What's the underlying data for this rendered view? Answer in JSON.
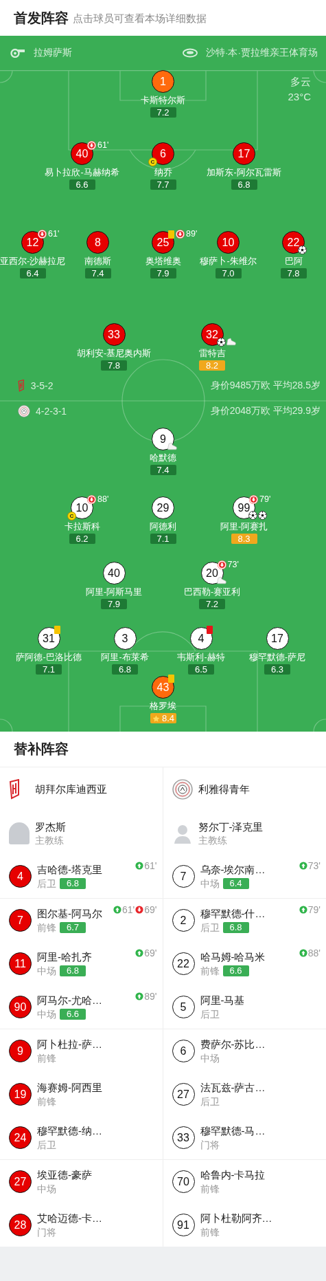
{
  "header": {
    "title": "首发阵容",
    "subtitle": "点击球员可查看本场详细数据"
  },
  "pitch": {
    "referee": "拉姆萨斯",
    "stadium": "沙特·本·贾拉维亲王体育场",
    "weather": "多云",
    "temperature": "23°C",
    "home": {
      "lines": [
        {
          "players": [
            {
              "number": "1",
              "name": "卡斯特尔斯",
              "rating": "7.2",
              "kind": "keeper",
              "top_rated": false,
              "mvp": false
            }
          ]
        },
        {
          "players": [
            {
              "number": "40",
              "name": "易卜拉欣-马赫纳希",
              "rating": "6.6",
              "kind": "outfield",
              "top_rated": false,
              "mvp": false,
              "events": [
                {
                  "kind": "sub-off",
                  "minute": "61'"
                }
              ]
            },
            {
              "number": "6",
              "name": "纳乔",
              "rating": "7.7",
              "kind": "outfield",
              "top_rated": false,
              "mvp": false,
              "events": [
                {
                  "kind": "captain",
                  "label": "C"
                }
              ]
            },
            {
              "number": "17",
              "name": "加斯东-阿尔瓦雷斯",
              "rating": "6.8",
              "kind": "outfield",
              "top_rated": false,
              "mvp": false
            }
          ]
        },
        {
          "players": [
            {
              "number": "12",
              "name": "亚西尔-沙赫拉尼",
              "rating": "6.4",
              "kind": "outfield",
              "top_rated": false,
              "mvp": false,
              "events": [
                {
                  "kind": "sub-off",
                  "minute": "61'"
                }
              ]
            },
            {
              "number": "8",
              "name": "南德斯",
              "rating": "7.4",
              "kind": "outfield",
              "top_rated": false,
              "mvp": false
            },
            {
              "number": "25",
              "name": "奥塔维奥",
              "rating": "7.9",
              "kind": "outfield",
              "top_rated": false,
              "mvp": false,
              "events": [
                {
                  "kind": "yellow"
                },
                {
                  "kind": "sub-off",
                  "minute": "89'"
                }
              ]
            },
            {
              "number": "10",
              "name": "穆萨卜-朱维尔",
              "rating": "7.0",
              "kind": "outfield",
              "top_rated": false,
              "mvp": false
            },
            {
              "number": "22",
              "name": "巴阿",
              "rating": "7.8",
              "kind": "outfield",
              "top_rated": false,
              "mvp": false,
              "events": [
                {
                  "kind": "goal"
                }
              ]
            }
          ]
        },
        {
          "players": [
            {
              "number": "33",
              "name": "胡利安-基尼奥内斯",
              "rating": "7.8",
              "kind": "outfield",
              "top_rated": false,
              "mvp": false
            },
            {
              "number": "32",
              "name": "雷特吉",
              "rating": "8.2",
              "kind": "outfield",
              "top_rated": true,
              "mvp": false,
              "events": [
                {
                  "kind": "goal"
                },
                {
                  "kind": "assist"
                }
              ]
            }
          ]
        }
      ]
    },
    "formations": [
      {
        "formation": "3-5-2",
        "value": "身价9485万欧 平均28.5岁"
      },
      {
        "formation": "4-2-3-1",
        "value": "身价2048万欧 平均29.9岁"
      }
    ],
    "away": {
      "lines": [
        {
          "players": [
            {
              "number": "9",
              "name": "哈默德",
              "rating": "7.4",
              "kind": "outfield",
              "top_rated": false,
              "mvp": false,
              "events": [
                {
                  "kind": "assist"
                }
              ]
            }
          ]
        },
        {
          "players": [
            {
              "number": "10",
              "name": "卡拉斯科",
              "rating": "6.2",
              "kind": "outfield",
              "top_rated": false,
              "mvp": false,
              "events": [
                {
                  "kind": "sub-off",
                  "minute": "88'"
                },
                {
                  "kind": "captain",
                  "label": "C"
                }
              ]
            },
            {
              "number": "29",
              "name": "阿德利",
              "rating": "7.1",
              "kind": "outfield",
              "top_rated": false,
              "mvp": false
            },
            {
              "number": "99",
              "name": "阿里-阿赛扎",
              "rating": "8.3",
              "kind": "outfield",
              "top_rated": true,
              "mvp": false,
              "events": [
                {
                  "kind": "sub-off",
                  "minute": "79'"
                },
                {
                  "kind": "goal"
                },
                {
                  "kind": "goal"
                }
              ]
            }
          ]
        },
        {
          "players": [
            {
              "number": "40",
              "name": "阿里-阿斯马里",
              "rating": "7.9",
              "kind": "outfield",
              "top_rated": false,
              "mvp": false
            },
            {
              "number": "20",
              "name": "巴西勒-赛亚利",
              "rating": "7.2",
              "kind": "outfield",
              "top_rated": false,
              "mvp": false,
              "events": [
                {
                  "kind": "sub-off",
                  "minute": "73'"
                },
                {
                  "kind": "assist"
                }
              ]
            }
          ]
        },
        {
          "players": [
            {
              "number": "31",
              "name": "萨阿德-巴洛比德",
              "rating": "7.1",
              "kind": "outfield",
              "top_rated": false,
              "mvp": false,
              "events": [
                {
                  "kind": "yellow"
                }
              ]
            },
            {
              "number": "3",
              "name": "阿里-布莱希",
              "rating": "6.8",
              "kind": "outfield",
              "top_rated": false,
              "mvp": false
            },
            {
              "number": "4",
              "name": "韦斯利-赫特",
              "rating": "6.5",
              "kind": "outfield",
              "top_rated": false,
              "mvp": false,
              "events": [
                {
                  "kind": "red"
                }
              ]
            },
            {
              "number": "17",
              "name": "穆罕默德-萨尼",
              "rating": "6.3",
              "kind": "outfield",
              "top_rated": false,
              "mvp": false
            }
          ]
        },
        {
          "players": [
            {
              "number": "43",
              "name": "格罗埃",
              "rating": "8.4",
              "kind": "keeper",
              "top_rated": true,
              "mvp": true,
              "events": [
                {
                  "kind": "yellow"
                }
              ]
            }
          ]
        }
      ]
    }
  },
  "subs": {
    "title": "替补阵容",
    "teams": [
      {
        "name": "胡拜尔库迪西亚"
      },
      {
        "name": "利雅得青年"
      }
    ],
    "coaches": [
      {
        "name": "罗杰斯",
        "role": "主教练",
        "photo": true
      },
      {
        "name": "努尔丁-泽克里",
        "role": "主教练",
        "photo": false
      }
    ],
    "groups": [
      {
        "pairs": [
          {
            "home": {
              "number": "4",
              "name": "吉哈德-塔克里",
              "position": "后卫",
              "rating": "6.8",
              "events": [
                {
                  "kind": "sub-on",
                  "minute": "61'"
                }
              ]
            },
            "away": {
              "number": "7",
              "name": "乌奈-埃尔南…",
              "position": "中场",
              "rating": "6.4",
              "events": [
                {
                  "kind": "sub-on",
                  "minute": "73'"
                }
              ]
            }
          }
        ]
      },
      {
        "pairs": [
          {
            "home": {
              "number": "7",
              "name": "图尔基-阿马尔",
              "position": "前锋",
              "rating": "6.7",
              "events": [
                {
                  "kind": "sub-on",
                  "minute": "61'"
                },
                {
                  "kind": "sub-off",
                  "minute": "69'"
                }
              ]
            },
            "away": {
              "number": "2",
              "name": "穆罕默德-什…",
              "position": "后卫",
              "rating": "6.8",
              "events": [
                {
                  "kind": "sub-on",
                  "minute": "79'"
                }
              ]
            }
          },
          {
            "home": {
              "number": "11",
              "name": "阿里-哈扎齐",
              "position": "中场",
              "rating": "6.8",
              "events": [
                {
                  "kind": "sub-on",
                  "minute": "69'"
                }
              ]
            },
            "away": {
              "number": "22",
              "name": "哈马姆-哈马米",
              "position": "前锋",
              "rating": "6.6",
              "events": [
                {
                  "kind": "sub-on",
                  "minute": "88'"
                }
              ]
            }
          },
          {
            "home": {
              "number": "90",
              "name": "阿马尔-尤哈…",
              "position": "中场",
              "rating": "6.6",
              "events": [
                {
                  "kind": "sub-on",
                  "minute": "89'"
                }
              ]
            },
            "away": {
              "number": "5",
              "name": "阿里-马基",
              "position": "后卫"
            }
          }
        ]
      },
      {
        "pairs": [
          {
            "home": {
              "number": "9",
              "name": "阿卜杜拉-萨…",
              "position": "前锋"
            },
            "away": {
              "number": "6",
              "name": "费萨尔-苏比…",
              "position": "中场"
            }
          },
          {
            "home": {
              "number": "19",
              "name": "海赛姆-阿西里",
              "position": "前锋"
            },
            "away": {
              "number": "27",
              "name": "法瓦兹-萨古…",
              "position": "后卫"
            }
          },
          {
            "home": {
              "number": "24",
              "name": "穆罕默德-纳…",
              "position": "后卫"
            },
            "away": {
              "number": "33",
              "name": "穆罕默德-马…",
              "position": "门将"
            }
          }
        ]
      },
      {
        "pairs": [
          {
            "home": {
              "number": "27",
              "name": "埃亚德-豪萨",
              "position": "中场"
            },
            "away": {
              "number": "70",
              "name": "哈鲁内-卡马拉",
              "position": "前锋"
            }
          },
          {
            "home": {
              "number": "28",
              "name": "艾哈迈德-卡…",
              "position": "门将"
            },
            "away": {
              "number": "91",
              "name": "阿卜杜勒阿齐…",
              "position": "前锋"
            }
          }
        ]
      }
    ]
  }
}
